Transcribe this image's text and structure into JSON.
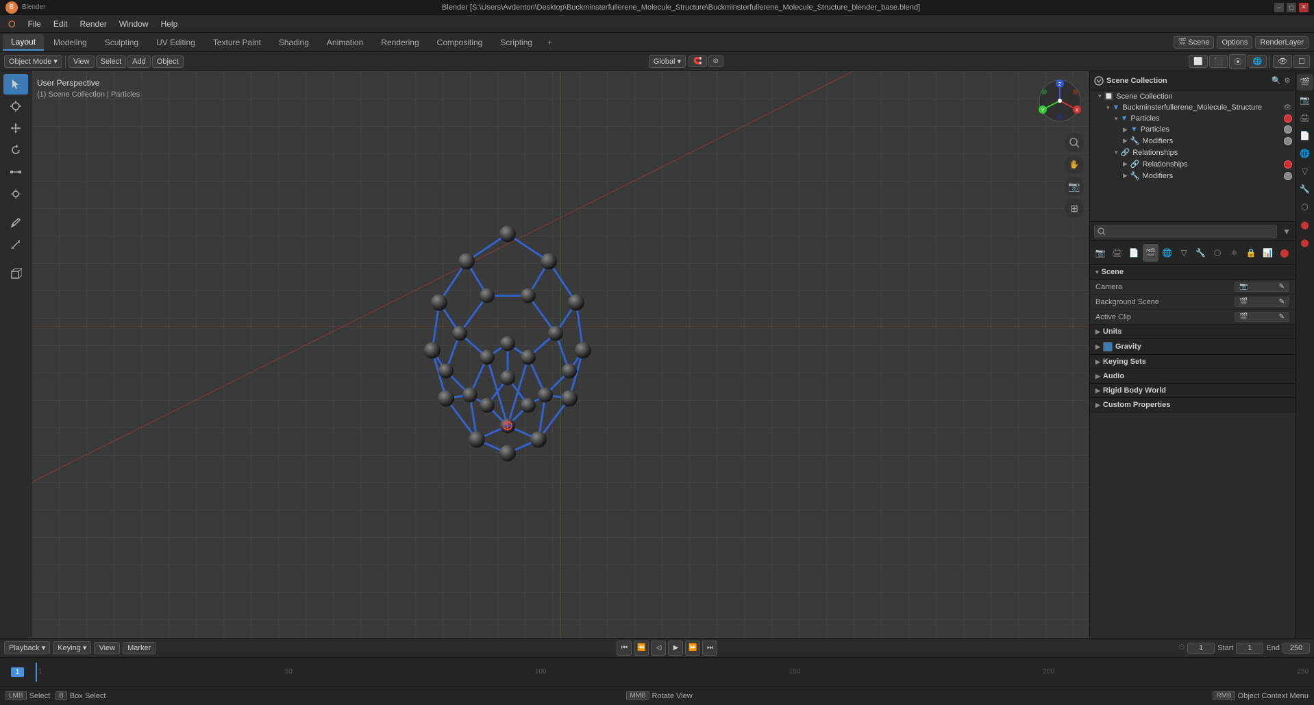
{
  "titlebar": {
    "title": "Blender [S:\\Users\\Avdenton\\Desktop\\Buckminsterfullerene_Molecule_Structure\\Buckminsterfullerene_Molecule_Structure_blender_base.blend]",
    "min": "–",
    "max": "□",
    "close": "✕"
  },
  "menubar": {
    "items": [
      "Blender",
      "File",
      "Edit",
      "Render",
      "Window",
      "Help"
    ]
  },
  "workspaceTabs": {
    "tabs": [
      "Layout",
      "Modeling",
      "Sculpting",
      "UV Editing",
      "Texture Paint",
      "Shading",
      "Animation",
      "Rendering",
      "Compositing",
      "Scripting"
    ],
    "active": "Layout",
    "plus": "+"
  },
  "toolbar": {
    "options_label": "Options",
    "global_label": "Global",
    "renderlayer_label": "RenderLayer",
    "scene_label": "Scene"
  },
  "viewport": {
    "mode_label": "Object Mode",
    "view_label": "View",
    "select_label": "Select",
    "add_label": "Add",
    "object_label": "Object",
    "perspective_label": "User Perspective",
    "collection_label": "(1) Scene Collection | Particles"
  },
  "outliner": {
    "title": "Scene Collection",
    "items": [
      {
        "name": "Buckminsterfullerene_Molecule_Structure",
        "level": 0,
        "expanded": true,
        "icon": "📁"
      },
      {
        "name": "Particles",
        "level": 1,
        "expanded": true,
        "icon": "🔺",
        "color": "#4a90d9"
      },
      {
        "name": "Particles",
        "level": 2,
        "expanded": false,
        "icon": "🔺",
        "color": "#4a90d9"
      },
      {
        "name": "Modifiers",
        "level": 2,
        "expanded": false,
        "icon": "🔧"
      },
      {
        "name": "Relationships",
        "level": 1,
        "expanded": true,
        "icon": "🔗"
      },
      {
        "name": "Relationships",
        "level": 2,
        "expanded": false,
        "icon": "🔗",
        "dot": "red"
      },
      {
        "name": "Modifiers",
        "level": 2,
        "expanded": false,
        "icon": "🔧"
      }
    ]
  },
  "properties": {
    "title": "Scene",
    "tabs": [
      "render",
      "output",
      "view",
      "scene",
      "world",
      "object",
      "particles",
      "physics",
      "constraints"
    ],
    "active_tab": "scene",
    "sections": {
      "scene": {
        "label": "Scene",
        "camera_label": "Camera",
        "camera_value": "",
        "background_scene_label": "Background Scene",
        "active_clip_label": "Active Clip"
      },
      "units": {
        "label": "Units",
        "collapsed": false
      },
      "gravity": {
        "label": "Gravity",
        "checked": true
      },
      "keying_sets": {
        "label": "Keying Sets"
      },
      "audio": {
        "label": "Audio"
      },
      "rigid_body_world": {
        "label": "Rigid Body World"
      },
      "custom_properties": {
        "label": "Custom Properties"
      }
    }
  },
  "playback": {
    "label": "Playback",
    "keying_label": "Keying",
    "view_label": "View",
    "marker_label": "Marker",
    "frame_current": "1",
    "frame_start_label": "Start",
    "frame_start": "1",
    "frame_end_label": "End",
    "frame_end": "250",
    "timeline_numbers": [
      "1",
      "50",
      "100",
      "150",
      "200",
      "250"
    ]
  },
  "statusbar": {
    "select_label": "Select",
    "box_select_label": "Box Select",
    "rotate_view_label": "Rotate View",
    "object_context_label": "Object Context Menu"
  },
  "nav_gizmo": {
    "x_color": "#cc3333",
    "y_color": "#33cc33",
    "z_color": "#3355cc"
  }
}
